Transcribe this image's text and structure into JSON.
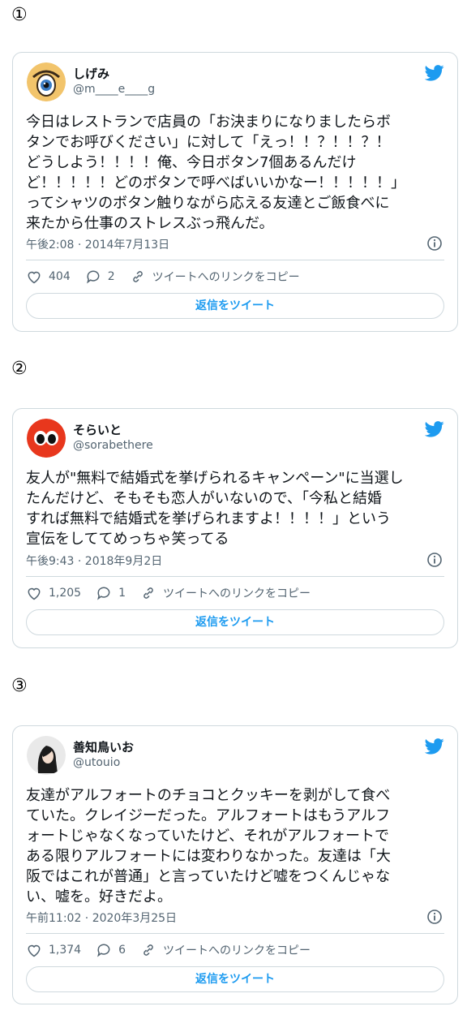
{
  "colors": {
    "accent": "#1d9bf0",
    "text": "#0f1419",
    "muted": "#536471",
    "border": "#cfd9de"
  },
  "tweets": [
    {
      "marker": "①",
      "name": "しげみ",
      "handle": "@m____e____g",
      "avatar": "eye-avatar",
      "text": "今日はレストランで店員の「お決まりになりましたらボ\nタンでお呼びください」に対して「えっ！！？！！？！\nどうしよう！！！！俺、今日ボタン7個あるんだけ\nど！！！！！どのボタンで呼べばいいかなー！！！！！」\nってシャツのボタン触りながら応える友達とご飯食べに\n来たから仕事のストレスぶっ飛んだ。",
      "timestamp": "午後2:08 · 2014年7月13日",
      "likes": "404",
      "replies": "2",
      "copy_link": "ツイートへのリンクをコピー",
      "reply_button": "返信をツイート"
    },
    {
      "marker": "②",
      "name": "そらいと",
      "handle": "@sorabethere",
      "avatar": "red-eyes-avatar",
      "text": "友人が\"無料で結婚式を挙げられるキャンペーン\"に当選し\nたんだけど、そもそも恋人がいないので、「今私と結婚\nすれば無料で結婚式を挙げられますよ！！！！」という\n宣伝をしててめっちゃ笑ってる",
      "timestamp": "午後9:43 · 2018年9月2日",
      "likes": "1,205",
      "replies": "1",
      "copy_link": "ツイートへのリンクをコピー",
      "reply_button": "返信をツイート"
    },
    {
      "marker": "③",
      "name": "善知鳥いお",
      "handle": "@utouio",
      "avatar": "photo-avatar",
      "text": "友達がアルフォートのチョコとクッキーを剥がして食べ\nていた。クレイジーだった。アルフォートはもうアルフ\nォートじゃなくなっていたけど、それがアルフォートで\nある限りアルフォートには変わりなかった。友達は「大\n阪ではこれが普通」と言っていたけど嘘をつくんじゃな\nい、嘘を。好きだよ。",
      "timestamp": "午前11:02 · 2020年3月25日",
      "likes": "1,374",
      "replies": "6",
      "copy_link": "ツイートへのリンクをコピー",
      "reply_button": "返信をツイート"
    }
  ]
}
